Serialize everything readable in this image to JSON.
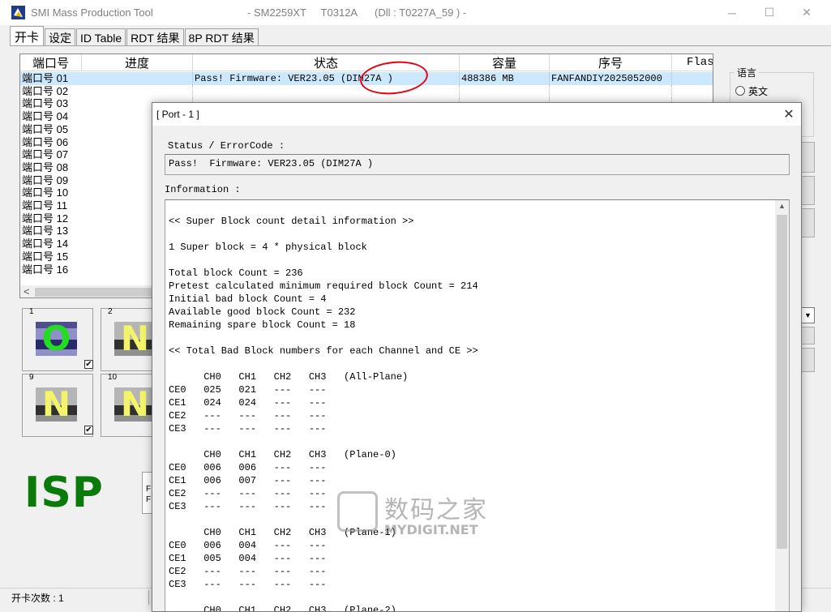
{
  "window": {
    "title": "SMI Mass Production Tool",
    "meta": "- SM2259XT     T0312A      (Dll : T0227A_59 ) -",
    "minimize": "─",
    "maximize": "☐",
    "close": "✕"
  },
  "tabs": [
    {
      "label": "开卡"
    },
    {
      "label": "设定"
    },
    {
      "label": "ID Table"
    },
    {
      "label": "RDT 结果"
    },
    {
      "label": "8P RDT 结果"
    }
  ],
  "port_list": {
    "columns": [
      "端口号",
      "进度",
      "状态",
      "容量",
      "序号",
      "Flas"
    ],
    "ports": [
      {
        "name": "端口号 01",
        "status": "Pass!  Firmware: VER23.05 (DIM27A )",
        "capacity": "488386 MB",
        "serial": "FANFANDIY2025052000"
      },
      {
        "name": "端口号 02"
      },
      {
        "name": "端口号 03"
      },
      {
        "name": "端口号 04"
      },
      {
        "name": "端口号 05"
      },
      {
        "name": "端口号 06"
      },
      {
        "name": "端口号 07"
      },
      {
        "name": "端口号 08"
      },
      {
        "name": "端口号 09"
      },
      {
        "name": "端口号 10"
      },
      {
        "name": "端口号 11"
      },
      {
        "name": "端口号 12"
      },
      {
        "name": "端口号 13"
      },
      {
        "name": "端口号 14"
      },
      {
        "name": "端口号 15"
      },
      {
        "name": "端口号 16"
      }
    ],
    "scroll_left": "<"
  },
  "tiles": [
    {
      "num": "1",
      "letter": "O",
      "checked": "✔"
    },
    {
      "num": "2",
      "letter": "N"
    },
    {
      "num": "9",
      "letter": "N",
      "checked": "✔"
    },
    {
      "num": "10",
      "letter": "N"
    }
  ],
  "isp_label": "ISP",
  "mini_box_text": "F\nF",
  "statusbar": {
    "text": "开卡次数 : 1"
  },
  "language": {
    "title": "语言",
    "option_en": "英文"
  },
  "dialog": {
    "title": "[ Port - 1 ]",
    "close": "✕",
    "status_label": "Status / ErrorCode :",
    "status_value": "Pass!  Firmware: VER23.05 (DIM27A )",
    "info_label": "Information :",
    "info_text": "<< Super Block count detail information >>\n\n1 Super block = 4 * physical block\n\nTotal block Count = 236\nPretest calculated minimum required block Count = 214\nInitial bad block Count = 4\nAvailable good block Count = 232\nRemaining spare block Count = 18\n\n<< Total Bad Block numbers for each Channel and CE >>\n\n      CH0   CH1   CH2   CH3   (All-Plane)\nCE0   025   021   ---   ---\nCE1   024   024   ---   ---\nCE2   ---   ---   ---   ---\nCE3   ---   ---   ---   ---\n\n      CH0   CH1   CH2   CH3   (Plane-0)\nCE0   006   006   ---   ---\nCE1   006   007   ---   ---\nCE2   ---   ---   ---   ---\nCE3   ---   ---   ---   ---\n\n      CH0   CH1   CH2   CH3   (Plane-1)\nCE0   006   004   ---   ---\nCE1   005   004   ---   ---\nCE2   ---   ---   ---   ---\nCE3   ---   ---   ---   ---\n\n      CH0   CH1   CH2   CH3   (Plane-2)",
    "scroll_up": "▲"
  },
  "watermark": {
    "cn": "数码之家",
    "en": "MYDIGIT.NET"
  },
  "colors": {
    "accent_green": "#0a7a0a",
    "highlight_red": "#e60012",
    "selection": "#cce8ff"
  }
}
